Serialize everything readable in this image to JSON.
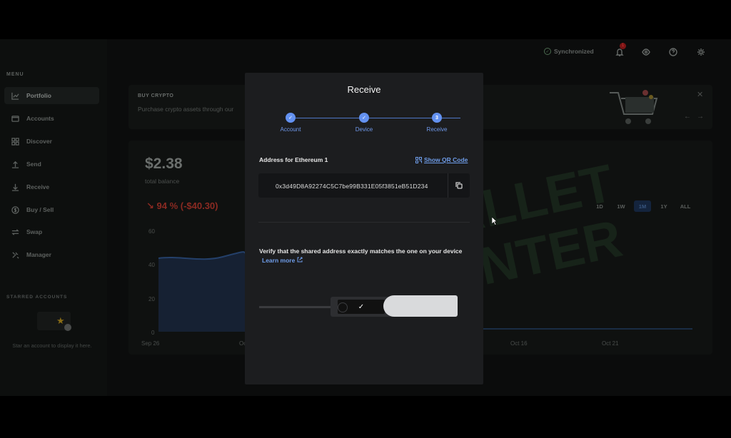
{
  "sidebar": {
    "menu_label": "MENU",
    "items": [
      {
        "label": "Portfolio",
        "icon": "chart-line-icon",
        "active": true
      },
      {
        "label": "Accounts",
        "icon": "folder-icon"
      },
      {
        "label": "Discover",
        "icon": "grid-icon"
      },
      {
        "label": "Send",
        "icon": "arrow-up-icon"
      },
      {
        "label": "Receive",
        "icon": "arrow-down-icon"
      },
      {
        "label": "Buy / Sell",
        "icon": "dollar-circle-icon"
      },
      {
        "label": "Swap",
        "icon": "swap-icon"
      },
      {
        "label": "Manager",
        "icon": "tools-icon"
      }
    ],
    "starred_label": "STARRED ACCOUNTS",
    "starred_hint": "Star an account to display it here."
  },
  "topbar": {
    "sync_label": "Synchronized",
    "notification_count": "1"
  },
  "banner": {
    "title": "BUY CRYPTO",
    "subtitle": "Purchase crypto assets through our"
  },
  "portfolio": {
    "balance": "$2.38",
    "balance_label": "total balance",
    "change": "↘ 94 % (-$40.30)",
    "ranges": [
      "1D",
      "1W",
      "1M",
      "1Y",
      "ALL"
    ],
    "active_range": "1M"
  },
  "chart_data": {
    "type": "area",
    "y_ticks": [
      "60",
      "40",
      "20",
      "0"
    ],
    "x_ticks": [
      "Sep 26",
      "Oc",
      "Oct 16",
      "Oct 21"
    ]
  },
  "modal": {
    "title": "Receive",
    "steps": [
      {
        "label": "Account",
        "state": "done"
      },
      {
        "label": "Device",
        "state": "done"
      },
      {
        "label": "Receive",
        "state": "current",
        "number": "3"
      }
    ],
    "address_label": "Address for Ethereum 1",
    "qr_link": "Show QR Code",
    "address": "0x3d49D8A92274C5C7be99B331E05f3851eB51D234",
    "verify_text": "Verify that the shared address exactly matches the one on your device",
    "learn_more": "Learn more"
  },
  "colors": {
    "accent": "#6391f0",
    "modal_bg": "#1c1d1f",
    "negative": "#8b2a22"
  }
}
